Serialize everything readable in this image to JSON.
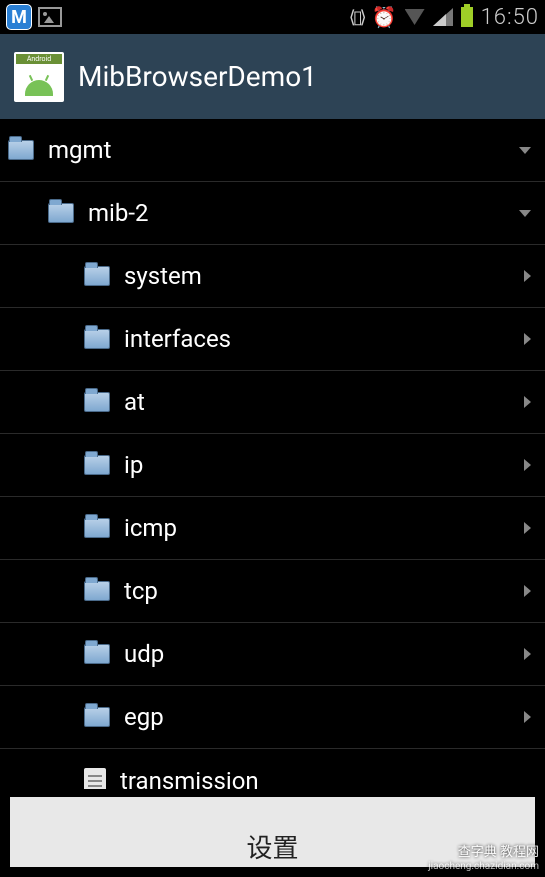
{
  "status": {
    "time": "16:50"
  },
  "header": {
    "title": "MibBrowserDemo1",
    "icon_badge": "Android"
  },
  "tree": [
    {
      "label": "mgmt",
      "level": 0,
      "icon": "folder",
      "expand": "down"
    },
    {
      "label": "mib-2",
      "level": 1,
      "icon": "folder",
      "expand": "down"
    },
    {
      "label": "system",
      "level": 2,
      "icon": "folder",
      "expand": "right"
    },
    {
      "label": "interfaces",
      "level": 2,
      "icon": "folder",
      "expand": "right"
    },
    {
      "label": "at",
      "level": 2,
      "icon": "folder",
      "expand": "right"
    },
    {
      "label": "ip",
      "level": 2,
      "icon": "folder",
      "expand": "right"
    },
    {
      "label": "icmp",
      "level": 2,
      "icon": "folder",
      "expand": "right"
    },
    {
      "label": "tcp",
      "level": 2,
      "icon": "folder",
      "expand": "right"
    },
    {
      "label": "udp",
      "level": 2,
      "icon": "folder",
      "expand": "right"
    },
    {
      "label": "egp",
      "level": 2,
      "icon": "folder",
      "expand": "right"
    },
    {
      "label": "transmission",
      "level": 2,
      "icon": "file",
      "expand": "none"
    }
  ],
  "bottom": {
    "button_label": "设置"
  },
  "watermark": {
    "line1": "查字典 教程网",
    "line2": "jiaocheng.chazidian.com"
  }
}
